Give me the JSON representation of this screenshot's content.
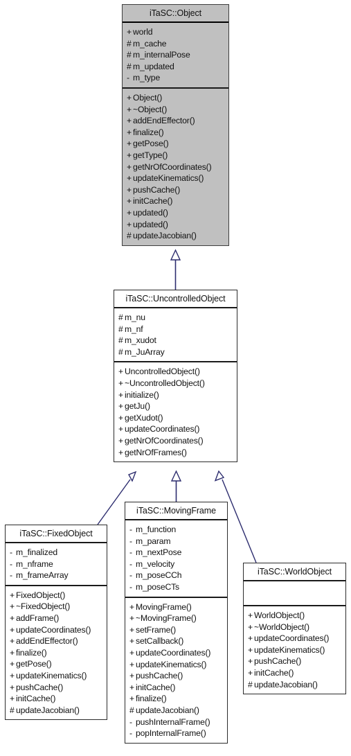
{
  "diagram": {
    "type": "uml-inheritance-diagram",
    "colors": {
      "highlight_fill": "#c0c0c0",
      "box_fill": "#ffffff",
      "border": "#2b2b2b",
      "connector": "#2c2c6e",
      "text": "#101010"
    },
    "classes": [
      {
        "id": "object",
        "name": "iTaSC::Object",
        "highlighted": true,
        "attributes": [
          {
            "visibility": "+",
            "name": "world"
          },
          {
            "visibility": "#",
            "name": "m_cache"
          },
          {
            "visibility": "#",
            "name": "m_internalPose"
          },
          {
            "visibility": "#",
            "name": "m_updated"
          },
          {
            "visibility": "-",
            "name": "m_type"
          }
        ],
        "methods": [
          {
            "visibility": "+",
            "name": "Object()"
          },
          {
            "visibility": "+",
            "name": "~Object()"
          },
          {
            "visibility": "+",
            "name": "addEndEffector()"
          },
          {
            "visibility": "+",
            "name": "finalize()"
          },
          {
            "visibility": "+",
            "name": "getPose()"
          },
          {
            "visibility": "+",
            "name": "getType()"
          },
          {
            "visibility": "+",
            "name": "getNrOfCoordinates()"
          },
          {
            "visibility": "+",
            "name": "updateKinematics()"
          },
          {
            "visibility": "+",
            "name": "pushCache()"
          },
          {
            "visibility": "+",
            "name": "initCache()"
          },
          {
            "visibility": "+",
            "name": "updated()"
          },
          {
            "visibility": "+",
            "name": "updated()"
          },
          {
            "visibility": "#",
            "name": "updateJacobian()"
          }
        ]
      },
      {
        "id": "uncontrolled",
        "name": "iTaSC::UncontrolledObject",
        "highlighted": false,
        "attributes": [
          {
            "visibility": "#",
            "name": "m_nu"
          },
          {
            "visibility": "#",
            "name": "m_nf"
          },
          {
            "visibility": "#",
            "name": "m_xudot"
          },
          {
            "visibility": "#",
            "name": "m_JuArray"
          }
        ],
        "methods": [
          {
            "visibility": "+",
            "name": "UncontrolledObject()"
          },
          {
            "visibility": "+",
            "name": "~UncontrolledObject()"
          },
          {
            "visibility": "+",
            "name": "initialize()"
          },
          {
            "visibility": "+",
            "name": "getJu()"
          },
          {
            "visibility": "+",
            "name": "getXudot()"
          },
          {
            "visibility": "+",
            "name": "updateCoordinates()"
          },
          {
            "visibility": "+",
            "name": "getNrOfCoordinates()"
          },
          {
            "visibility": "+",
            "name": "getNrOfFrames()"
          }
        ]
      },
      {
        "id": "fixed",
        "name": "iTaSC::FixedObject",
        "highlighted": false,
        "attributes": [
          {
            "visibility": "-",
            "name": "m_finalized"
          },
          {
            "visibility": "-",
            "name": "m_nframe"
          },
          {
            "visibility": "-",
            "name": "m_frameArray"
          }
        ],
        "methods": [
          {
            "visibility": "+",
            "name": "FixedObject()"
          },
          {
            "visibility": "+",
            "name": "~FixedObject()"
          },
          {
            "visibility": "+",
            "name": "addFrame()"
          },
          {
            "visibility": "+",
            "name": "updateCoordinates()"
          },
          {
            "visibility": "+",
            "name": "addEndEffector()"
          },
          {
            "visibility": "+",
            "name": "finalize()"
          },
          {
            "visibility": "+",
            "name": "getPose()"
          },
          {
            "visibility": "+",
            "name": "updateKinematics()"
          },
          {
            "visibility": "+",
            "name": "pushCache()"
          },
          {
            "visibility": "+",
            "name": "initCache()"
          },
          {
            "visibility": "#",
            "name": "updateJacobian()"
          }
        ]
      },
      {
        "id": "moving",
        "name": "iTaSC::MovingFrame",
        "highlighted": false,
        "attributes": [
          {
            "visibility": "-",
            "name": "m_function"
          },
          {
            "visibility": "-",
            "name": "m_param"
          },
          {
            "visibility": "-",
            "name": "m_nextPose"
          },
          {
            "visibility": "-",
            "name": "m_velocity"
          },
          {
            "visibility": "-",
            "name": "m_poseCCh"
          },
          {
            "visibility": "-",
            "name": "m_poseCTs"
          }
        ],
        "methods": [
          {
            "visibility": "+",
            "name": "MovingFrame()"
          },
          {
            "visibility": "+",
            "name": "~MovingFrame()"
          },
          {
            "visibility": "+",
            "name": "setFrame()"
          },
          {
            "visibility": "+",
            "name": "setCallback()"
          },
          {
            "visibility": "+",
            "name": "updateCoordinates()"
          },
          {
            "visibility": "+",
            "name": "updateKinematics()"
          },
          {
            "visibility": "+",
            "name": "pushCache()"
          },
          {
            "visibility": "+",
            "name": "initCache()"
          },
          {
            "visibility": "+",
            "name": "finalize()"
          },
          {
            "visibility": "#",
            "name": "updateJacobian()"
          },
          {
            "visibility": "-",
            "name": "pushInternalFrame()"
          },
          {
            "visibility": "-",
            "name": "popInternalFrame()"
          }
        ]
      },
      {
        "id": "world",
        "name": "iTaSC::WorldObject",
        "highlighted": false,
        "attributes": [],
        "methods": [
          {
            "visibility": "+",
            "name": "WorldObject()"
          },
          {
            "visibility": "+",
            "name": "~WorldObject()"
          },
          {
            "visibility": "+",
            "name": "updateCoordinates()"
          },
          {
            "visibility": "+",
            "name": "updateKinematics()"
          },
          {
            "visibility": "+",
            "name": "pushCache()"
          },
          {
            "visibility": "+",
            "name": "initCache()"
          },
          {
            "visibility": "#",
            "name": "updateJacobian()"
          }
        ]
      }
    ],
    "inheritances": [
      {
        "from": "uncontrolled",
        "to": "object"
      },
      {
        "from": "fixed",
        "to": "uncontrolled"
      },
      {
        "from": "moving",
        "to": "uncontrolled"
      },
      {
        "from": "world",
        "to": "uncontrolled"
      }
    ]
  }
}
